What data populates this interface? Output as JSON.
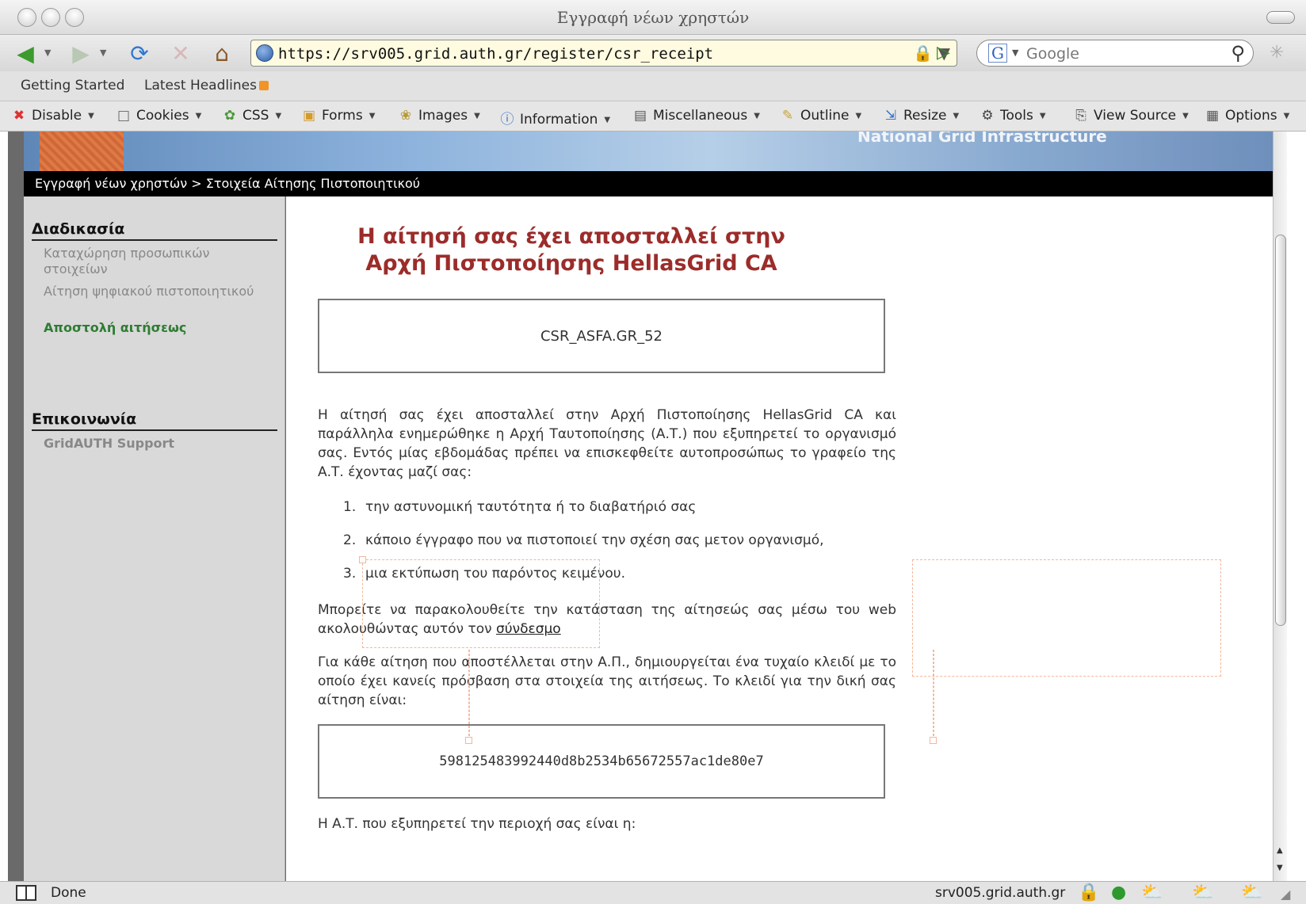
{
  "window": {
    "title": "Εγγραφή νέων χρηστών"
  },
  "toolbar": {
    "url": "https://srv005.grid.auth.gr/register/csr_receipt",
    "search_placeholder": "Google"
  },
  "bookmarks": [
    "Getting Started",
    "Latest Headlines"
  ],
  "devbar": [
    {
      "label": "Disable",
      "icon": "no-icon"
    },
    {
      "label": "Cookies",
      "icon": "cookie-icon"
    },
    {
      "label": "CSS",
      "icon": "css-icon"
    },
    {
      "label": "Forms",
      "icon": "forms-icon"
    },
    {
      "label": "Images",
      "icon": "images-icon"
    },
    {
      "label": "Information",
      "icon": "info-icon"
    },
    {
      "label": "Miscellaneous",
      "icon": "misc-icon"
    },
    {
      "label": "Outline",
      "icon": "pencil-icon"
    },
    {
      "label": "Resize",
      "icon": "resize-icon"
    },
    {
      "label": "Tools",
      "icon": "tools-icon"
    },
    {
      "label": "View Source",
      "icon": "source-icon"
    },
    {
      "label": "Options",
      "icon": "options-icon"
    }
  ],
  "banner": {
    "text": "National Grid Infrastructure"
  },
  "breadcrumb": "Εγγραφή νέων χρηστών > Στοιχεία Αίτησης Πιστοποιητικού",
  "sidebar": {
    "section1_title": "Διαδικασία",
    "steps": [
      "Καταχώρηση προσωπικών στοιχείων",
      "Αίτηση ψηφιακού πιστοποιητικού",
      "Αποστολή αιτήσεως"
    ],
    "section2_title": "Επικοινωνία",
    "support": "GridAUTH Support"
  },
  "main": {
    "heading": "Η αίτησή σας έχει αποσταλλεί στην Αρχή Πιστοποίησης HellasGrid CA",
    "csr_id": "CSR_ASFA.GR_52",
    "intro": "Η αίτησή σας έχει αποσταλλεί στην Αρχή Πιστοποίησης HellasGrid CA και παράλληλα ενημερώθηκε η Αρχή Ταυτοποίησης (Α.Τ.) που εξυπηρετεί το οργανισμό σας. Εντός μίας εβδομάδας πρέπει να επισκεφθείτε αυτοπροσώπως το γραφείο της Α.Τ. έχοντας μαζί σας:",
    "list": [
      "την αστυνομική ταυτότητα ή το διαβατήριό σας",
      "κάποιο έγγραφο που να πιστοποιεί την σχέση σας μετον οργανισμό,",
      "μια εκτύπωση του παρόντος κειμένου."
    ],
    "track_text": "Μπορείτε να παρακολουθείτε την κατάσταση της αίτησεώς σας μέσω του web ακολουθώντας αυτόν τον",
    "track_link": "σύνδεσμο",
    "key_text": "Για κάθε αίτηση που αποστέλλεται στην Α.Π., δημιουργείται ένα τυχαίο κλειδί με το οποίο έχει κανείς πρόσβαση στα στοιχεία της αιτήσεως. Το κλειδί για την δική σας αίτηση είναι:",
    "key": "598125483992440d8b2534b65672557ac1de80e7",
    "ra_text": "Η Α.Τ. που εξυπηρετεί την περιοχή σας είναι η:"
  },
  "status": {
    "text": "Done",
    "host": "srv005.grid.auth.gr"
  }
}
